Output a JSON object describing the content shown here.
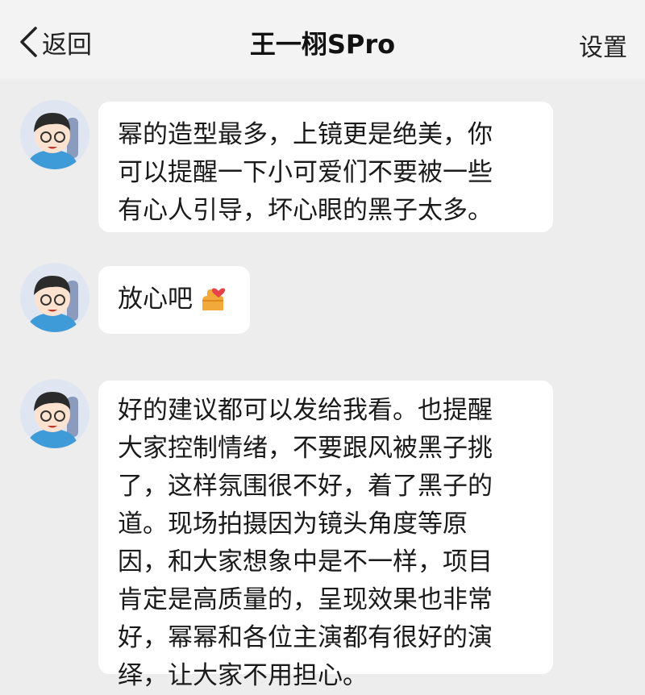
{
  "header": {
    "back_label": "返回",
    "title": "王一栩SPro",
    "settings_label": "设置"
  },
  "messages": [
    {
      "sender": "王一栩SPro",
      "lines": [
        "幂的造型最多，上镜更是绝美，你",
        "可以提醒一下小可爱们不要被一些",
        "有心人引导，坏心眼的黑子太多。"
      ]
    },
    {
      "sender": "王一栩SPro",
      "lines": [
        "放心吧"
      ],
      "emoji": "hand-heart-emoji"
    },
    {
      "sender": "王一栩SPro",
      "lines": [
        "好的建议都可以发给我看。也提醒",
        "大家控制情绪，不要跟风被黑子挑",
        "了，这样氛围很不好，着了黑子的",
        "道。现场拍摄因为镜头角度等原",
        "因，和大家想象中是不一样，项目",
        "肯定是高质量的，呈现效果也非常",
        "好，幂幂和各位主演都有很好的演",
        "绎，让大家不用担心。"
      ]
    }
  ],
  "colors": {
    "background": "#ededed",
    "bubble": "#ffffff",
    "header_bg": "#f3f3f3"
  }
}
